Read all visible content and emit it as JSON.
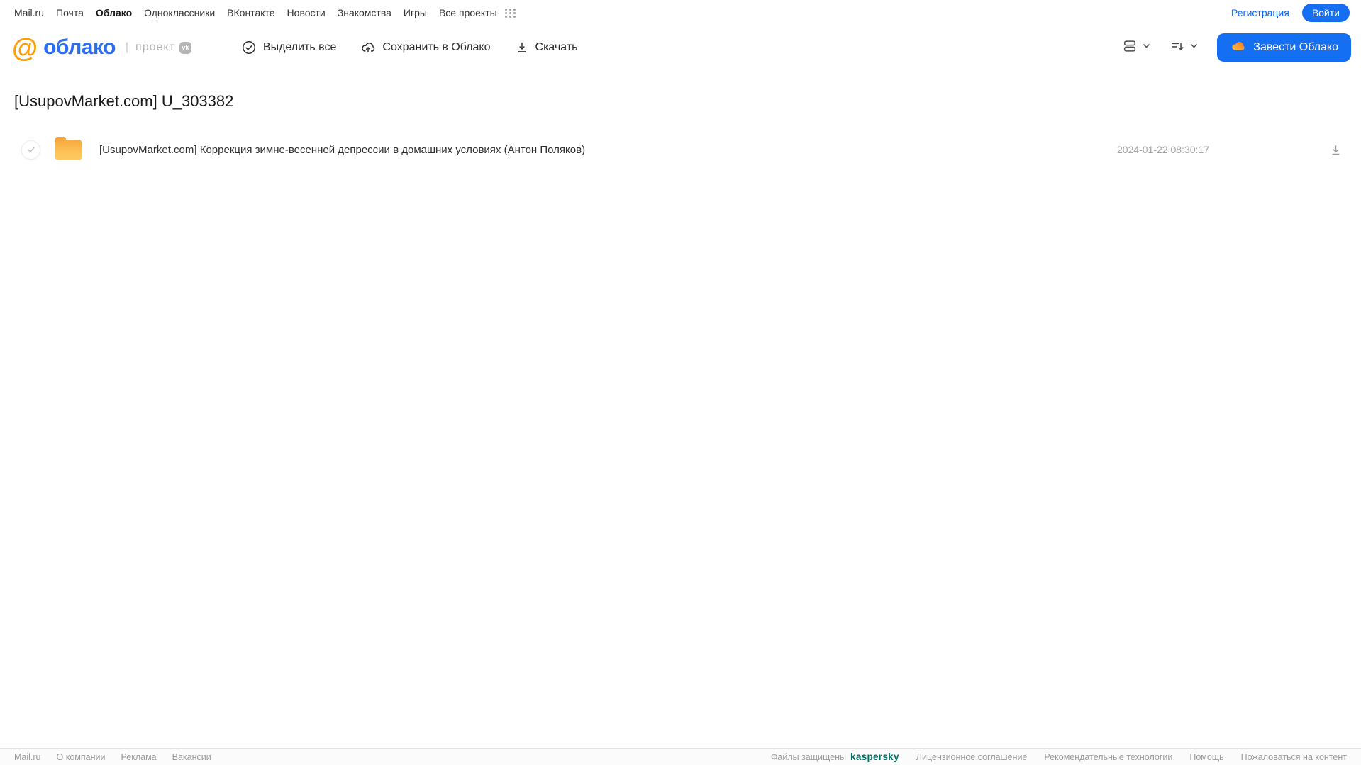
{
  "topnav": {
    "links": [
      "Mail.ru",
      "Почта",
      "Облако",
      "Одноклассники",
      "ВКонтакте",
      "Новости",
      "Знакомства",
      "Игры",
      "Все проекты"
    ],
    "registration_label": "Регистрация",
    "login_label": "Войти"
  },
  "header": {
    "logo": {
      "at_symbol": "@",
      "brand": "облако",
      "divider": "|",
      "project_label": "проект",
      "vk_badge": "vk"
    },
    "toolbar": {
      "select_all": "Выделить все",
      "save_to_cloud": "Сохранить в Облако",
      "download": "Скачать"
    },
    "create_cloud_label": "Завести Облако"
  },
  "main": {
    "title": "[UsupovMarket.com] U_303382",
    "files": [
      {
        "type": "folder",
        "name": "[UsupovMarket.com] Коррекция зимне-весенней депрессии в домашних условиях (Антон Поляков)",
        "date": "2024-01-22 08:30:17"
      }
    ]
  },
  "footer": {
    "links_left": [
      "Mail.ru",
      "О компании",
      "Реклама",
      "Вакансии"
    ],
    "protected_label": "Файлы защищены",
    "kaspersky_label": "kaspersky",
    "links_right": [
      "Лицензионное соглашение",
      "Рекомендательные технологии",
      "Помощь",
      "Пожаловаться на контент"
    ]
  },
  "colors": {
    "accent_blue": "#146ff2",
    "link_blue": "#0b63f5",
    "logo_blue": "#2a6ef5",
    "logo_orange": "#ff9e00",
    "folder_top": "#f7a83e",
    "folder_bottom": "#fdc85e",
    "kaspersky_green": "#006d64",
    "text_dark": "#2c2d2e",
    "text_gray": "#a3a3a3"
  }
}
